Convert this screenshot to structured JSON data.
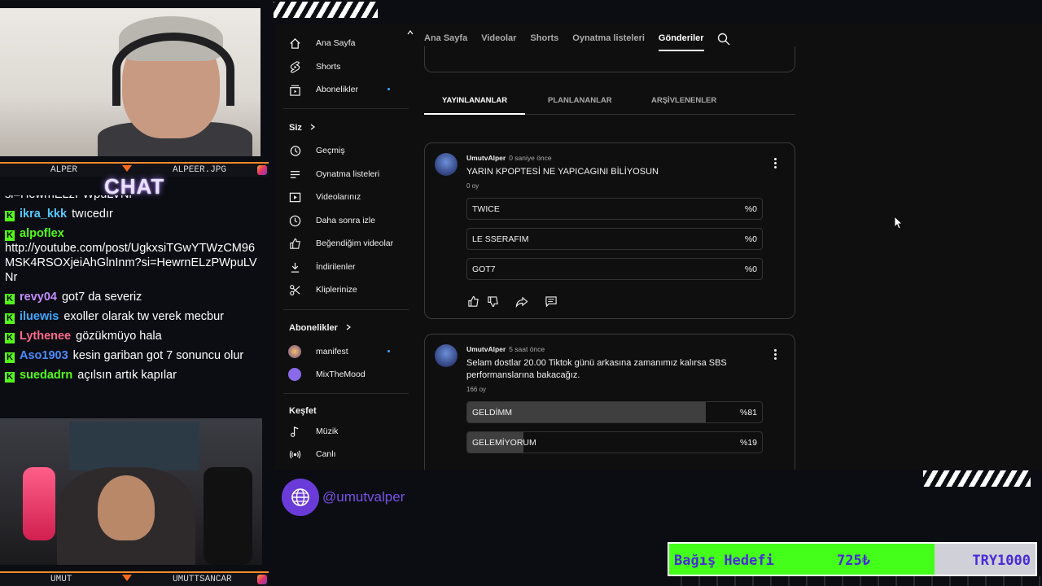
{
  "overlay": {
    "cam_top_name_left": "ALPER",
    "cam_top_name_right": "ALPEER.JPG",
    "cam_bottom_name_left": "UMUT",
    "cam_bottom_name_right": "UMUTTSANCAR",
    "chat_title": "CHAT",
    "handle": "@umutvalper",
    "donation": {
      "label": "Bağış Hedefi",
      "current": "725₺",
      "goal": "TRY1000",
      "progress": 0.725
    }
  },
  "chat": {
    "cut_line": "si=HewrnELzPWpuLVNr",
    "messages": [
      {
        "user": "ikra_kkk",
        "color": "#55c9ff",
        "text": "twıcedır"
      },
      {
        "user": "alpoflex",
        "color": "#53fc18",
        "text": "http://youtube.com/post/UgkxsiTGwYTWzCM96MSK4RSOXjeiAhGlnInm?si=HewrnELzPWpuLVNr",
        "block": true
      },
      {
        "user": "revy04",
        "color": "#c48bff",
        "text": "got7 da severiz"
      },
      {
        "user": "iluewis",
        "color": "#3fa9ff",
        "text": "exoller olarak tw verek mecbur"
      },
      {
        "user": "Lythenee",
        "color": "#ff6a8a",
        "text": "gözükmüyo hala"
      },
      {
        "user": "Aso1903",
        "color": "#4a8bff",
        "text": "kesin gariban got 7 sonuncu olur"
      },
      {
        "user": "suedadrn",
        "color": "#53fc18",
        "text": "açılsın artık kapılar"
      }
    ]
  },
  "youtube": {
    "sidebar": {
      "main": [
        {
          "label": "Ana Sayfa",
          "icon": "home-icon"
        },
        {
          "label": "Shorts",
          "icon": "shorts-icon"
        },
        {
          "label": "Abonelikler",
          "icon": "subscriptions-icon",
          "dot": true
        }
      ],
      "you_title": "Siz",
      "you": [
        {
          "label": "Geçmiş",
          "icon": "history-icon"
        },
        {
          "label": "Oynatma listeleri",
          "icon": "playlists-icon"
        },
        {
          "label": "Videolarınız",
          "icon": "your-videos-icon"
        },
        {
          "label": "Daha sonra izle",
          "icon": "watch-later-icon"
        },
        {
          "label": "Beğendiğim videolar",
          "icon": "liked-icon"
        },
        {
          "label": "İndirilenler",
          "icon": "download-icon"
        },
        {
          "label": "Kliplerinize",
          "icon": "clips-icon"
        }
      ],
      "subs_title": "Abonelikler",
      "subs": [
        {
          "label": "manifest",
          "dot": true
        },
        {
          "label": "MixTheMood"
        }
      ],
      "explore_title": "Keşfet",
      "explore": [
        {
          "label": "Müzik",
          "icon": "music-icon"
        },
        {
          "label": "Canlı",
          "icon": "live-icon"
        }
      ]
    },
    "tabs": [
      "Ana Sayfa",
      "Videolar",
      "Shorts",
      "Oynatma listeleri",
      "Gönderiler"
    ],
    "active_tab": "Gönderiler",
    "subtabs": [
      "YAYINLANANLAR",
      "PLANLANANLAR",
      "ARŞİVLENENLER"
    ],
    "posts": [
      {
        "author": "UmutvAlper",
        "time": "0 saniye önce",
        "text": "YARIN KPOPTESİ NE YAPICAGINI BİLİYOSUN",
        "votes": "0 oy",
        "options": [
          {
            "label": "TWICE",
            "pct": "%0",
            "fraction": 0
          },
          {
            "label": "LE SSERAFIM",
            "pct": "%0",
            "fraction": 0
          },
          {
            "label": "GOT7",
            "pct": "%0",
            "fraction": 0
          }
        ]
      },
      {
        "author": "UmutvAlper",
        "time": "5 saat önce",
        "text": "Selam dostlar 20.00 Tiktok günü arkasına zamanımız kalırsa SBS performanslarına bakacağız.",
        "votes": "166 oy",
        "options": [
          {
            "label": "GELDİMM",
            "pct": "%81",
            "fraction": 0.81
          },
          {
            "label": "GELEMİYORUM",
            "pct": "%19",
            "fraction": 0.19
          }
        ]
      }
    ]
  }
}
